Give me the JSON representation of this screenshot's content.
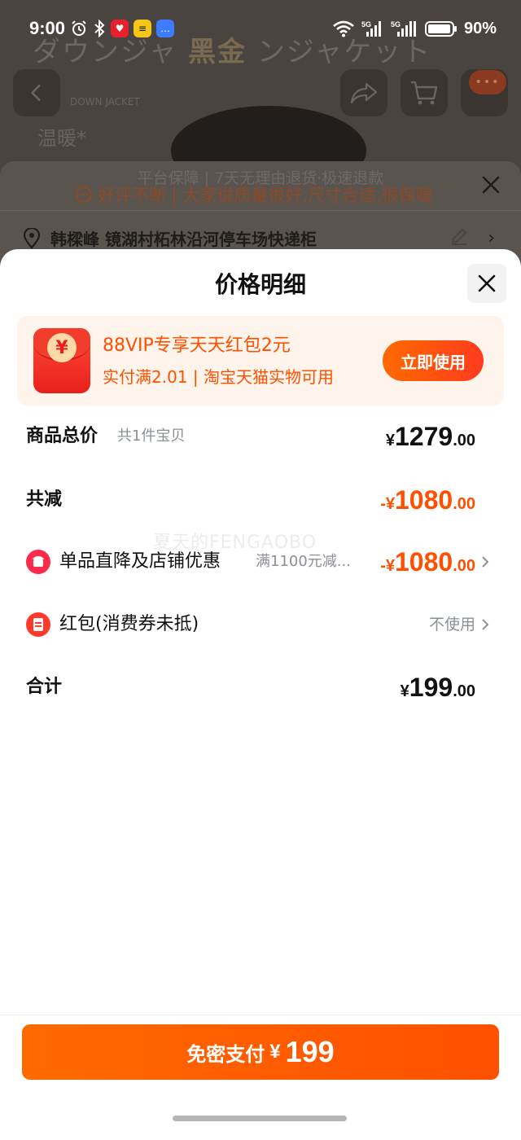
{
  "status_bar": {
    "time": "9:00",
    "battery": "90%",
    "network": "5G"
  },
  "background": {
    "banner_gold": "黑金",
    "banner_latin": "DOWN JACKET",
    "warm_text": "温暖*",
    "guarantee_text": "平台保障 | 7天无理由退货·极速退款",
    "review_text": "好评不断 | 大家说质量很好,尺寸合适,很保暖",
    "address": "韩樑峰 镜湖村柘林沿河停车场快递柜"
  },
  "sheet": {
    "title": "价格明细"
  },
  "coupon": {
    "title": "88VIP专享天天红包2元",
    "desc": "实付满2.01 | 淘宝天猫实物可用",
    "button": "立即使用",
    "coin": "¥"
  },
  "rows": {
    "total": {
      "label": "商品总价",
      "sub": "共1件宝贝",
      "sym": "¥",
      "int": "1279",
      "dec": ".00"
    },
    "reduce": {
      "label": "共减",
      "sym": "-¥",
      "int": "1080",
      "dec": ".00"
    },
    "discount": {
      "label": "单品直降及店铺优惠",
      "promo": "满1100元减...",
      "sym": "-¥",
      "int": "1080",
      "dec": ".00"
    },
    "redpacket": {
      "label": "红包(消费券未抵)",
      "value": "不使用"
    },
    "sum": {
      "label": "合计",
      "sym": "¥",
      "int": "199",
      "dec": ".00"
    }
  },
  "watermark": "夏天的FENGAOBO",
  "pay": {
    "label": "免密支付",
    "sym": "¥",
    "amount": "199"
  },
  "colors": {
    "accent": "#ff5000",
    "text": "#111111",
    "muted": "#8a8f99"
  }
}
